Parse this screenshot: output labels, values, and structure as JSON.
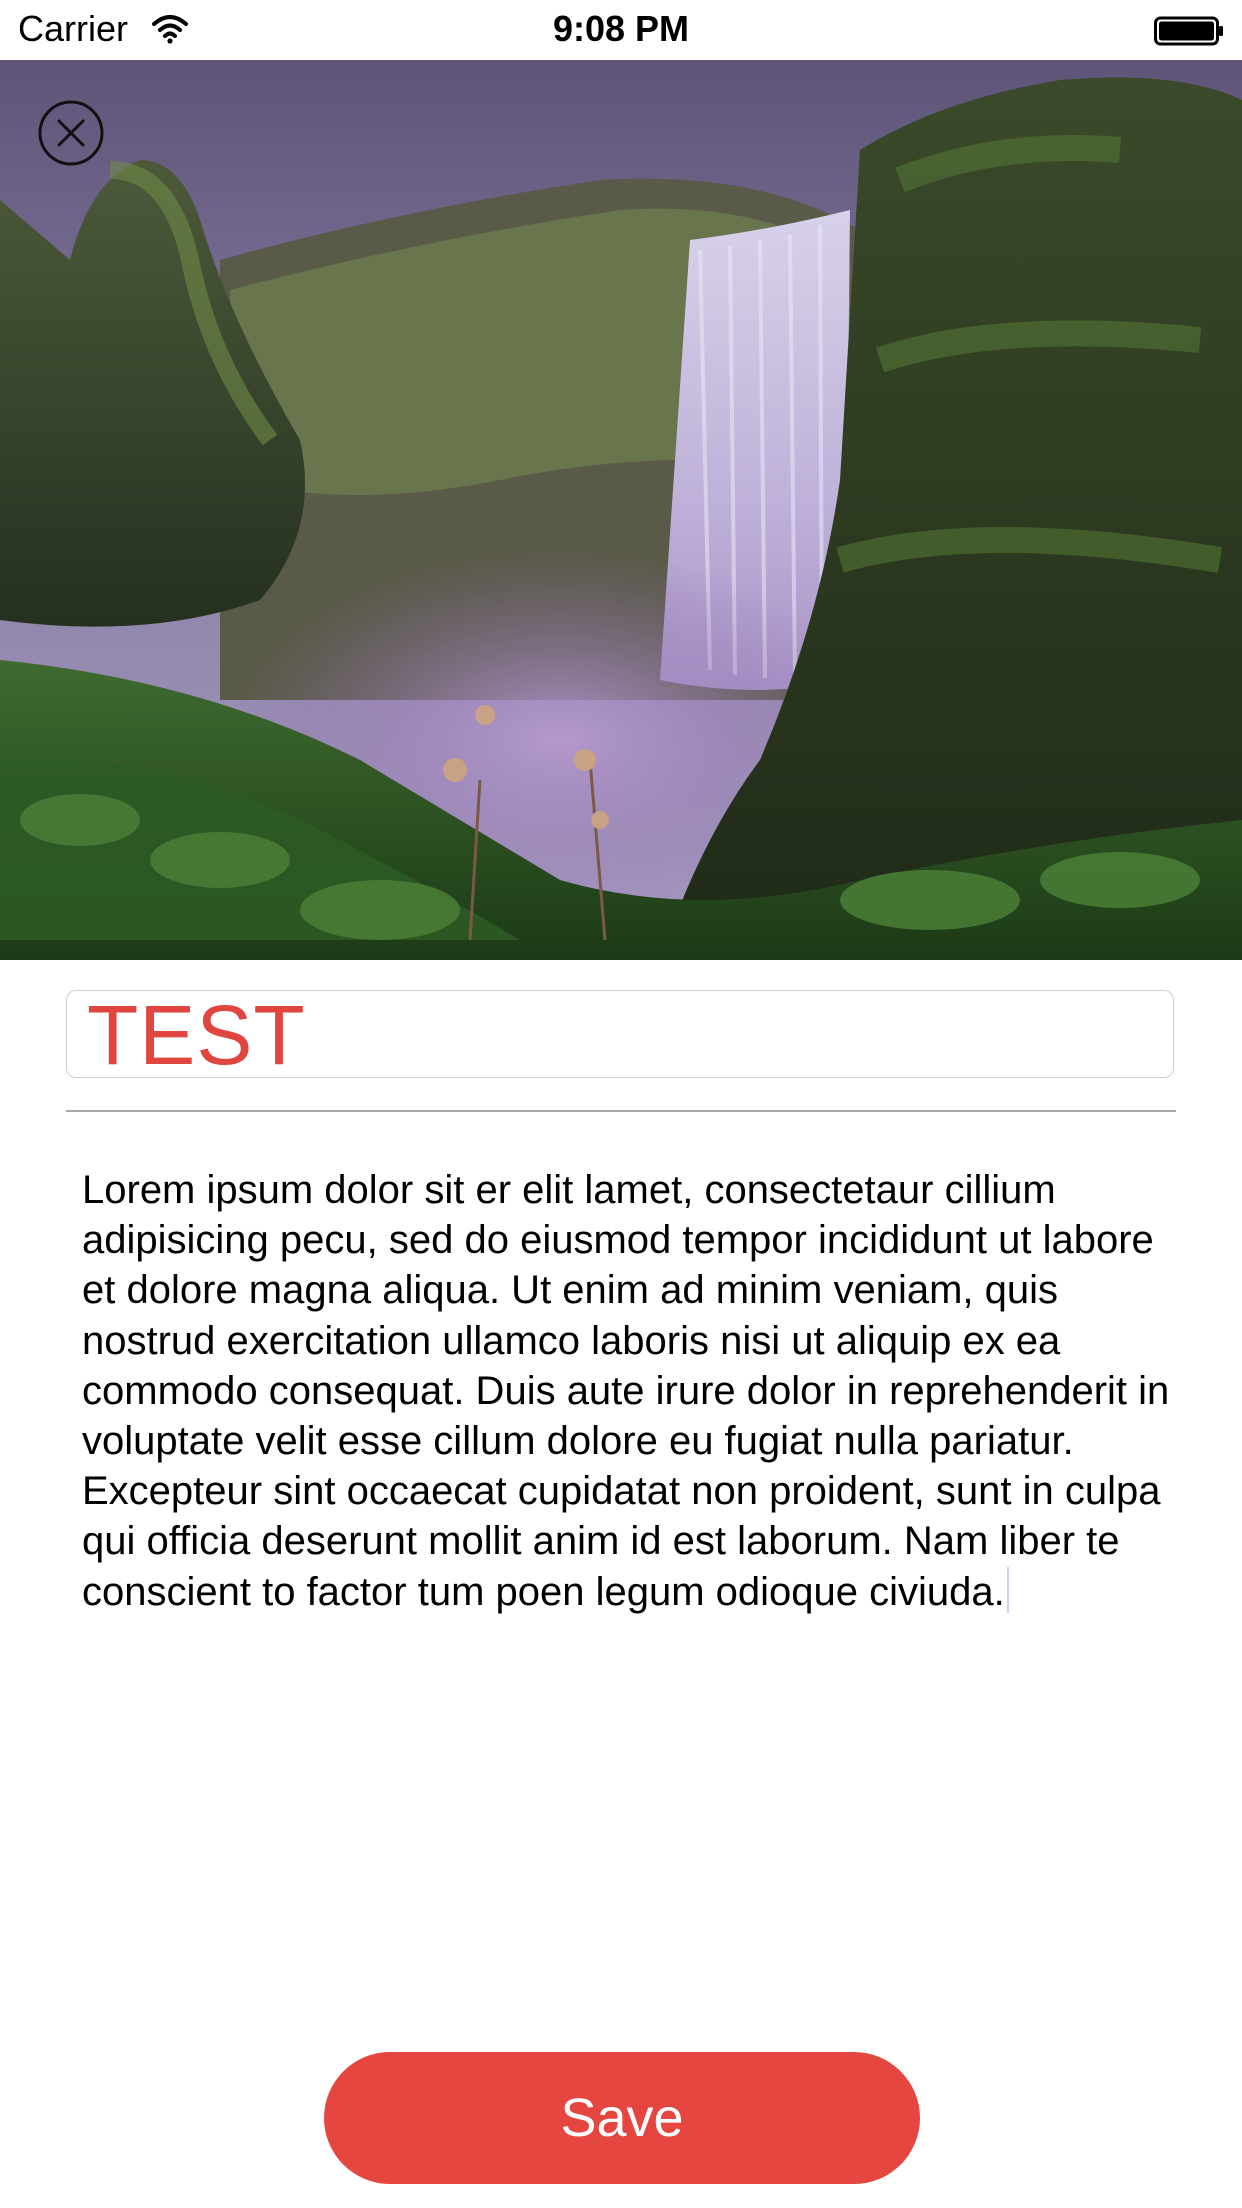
{
  "status_bar": {
    "carrier": "Carrier",
    "time": "9:08 PM",
    "wifi_icon": "wifi-icon",
    "battery_icon": "battery-icon"
  },
  "hero": {
    "image": "waterfall-photo",
    "close_icon": "close-icon"
  },
  "title_field": {
    "value": "TEST",
    "color": "#e0453f"
  },
  "body": {
    "text": "Lorem ipsum dolor sit er elit lamet, consectetaur cillium adipisicing pecu, sed do eiusmod tempor incididunt ut labore et dolore magna aliqua. Ut enim ad minim veniam, quis nostrud exercitation ullamco laboris nisi ut aliquip ex ea commodo consequat. Duis aute irure dolor in reprehenderit in voluptate velit esse cillum dolore eu fugiat nulla pariatur. Excepteur sint occaecat cupidatat non proident, sunt in culpa qui officia deserunt mollit anim id est laborum. Nam liber te conscient to factor tum poen legum odioque civiuda."
  },
  "save_button": {
    "label": "Save",
    "color": "#e5463f"
  }
}
